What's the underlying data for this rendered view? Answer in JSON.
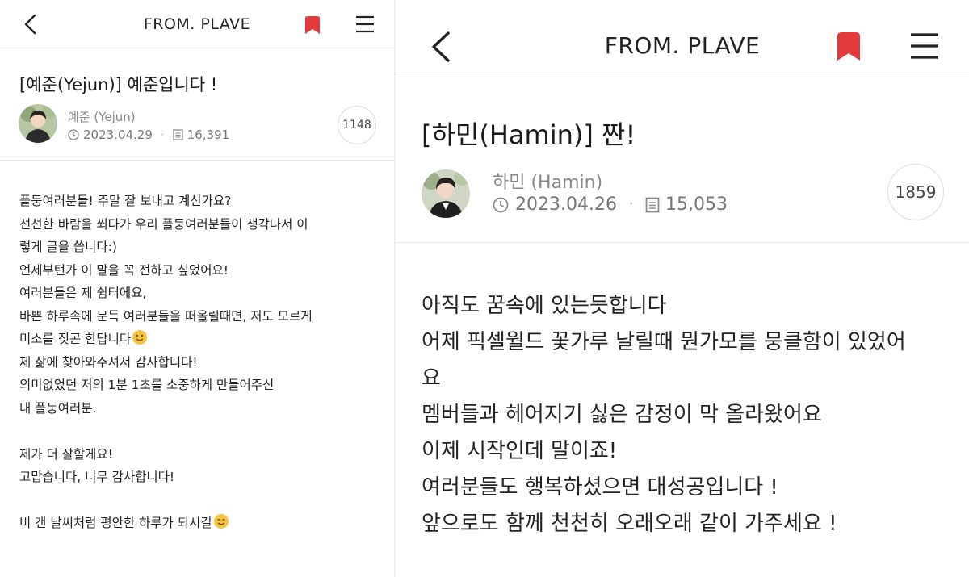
{
  "left_panel": {
    "header": {
      "title": "FROM. PLAVE"
    },
    "post": {
      "title": "[예준(Yejun)] 예준입니다 !",
      "author": "예준 (Yejun)",
      "date": "2023.04.29",
      "views": "16,391",
      "count": "1148"
    },
    "body_lines": [
      "플둥여러분들! 주말 잘 보내고 계신가요?",
      "선선한 바람을 쐬다가 우리 플둥여러분들이 생각나서 이",
      "렇게 글을 씁니다:)",
      "언제부턴가 이 말을 꼭 전하고 싶었어요!",
      "여러분들은 제 쉼터에요,",
      "바쁜 하루속에 문득 여러분들을 떠올릴때면, 저도 모르게",
      "미소를 짓곤 한답니다",
      "제 삶에 찾아와주셔서 감사합니다!",
      "의미없었던 저의 1분 1초를 소중하게 만들어주신",
      "내 플둥여러분.",
      "",
      "제가 더 잘할게요!",
      "고맙습니다, 너무 감사합니다!",
      "",
      "비 갠 날씨처럼 평안한 하루가 되시길"
    ]
  },
  "right_panel": {
    "header": {
      "title": "FROM. PLAVE"
    },
    "post": {
      "title": "[하민(Hamin)] 짠!",
      "author": "하민 (Hamin)",
      "date": "2023.04.26",
      "views": "15,053",
      "count": "1859"
    },
    "body_lines": [
      "아직도 꿈속에 있는듯합니다",
      "어제 픽셀월드 꽃가루 날릴때 뭔가모를 뭉클함이 있었어",
      "요",
      "멤버들과 헤어지기 싫은 감정이 막 올라왔어요",
      "이제 시작인데 말이죠!",
      "여러분들도 행복하셨으면 대성공입니다 !",
      "앞으로도 함께 천천히 오래오래 같이 가주세요 !"
    ]
  },
  "colors": {
    "bookmark": "#e23a3a",
    "meta_text": "#777777",
    "divider": "#e8e8e8",
    "emoji": "#f6c343"
  },
  "icons": [
    "back-icon",
    "bookmark-icon",
    "menu-icon",
    "clock-icon",
    "document-icon",
    "smile-emoji-icon"
  ]
}
